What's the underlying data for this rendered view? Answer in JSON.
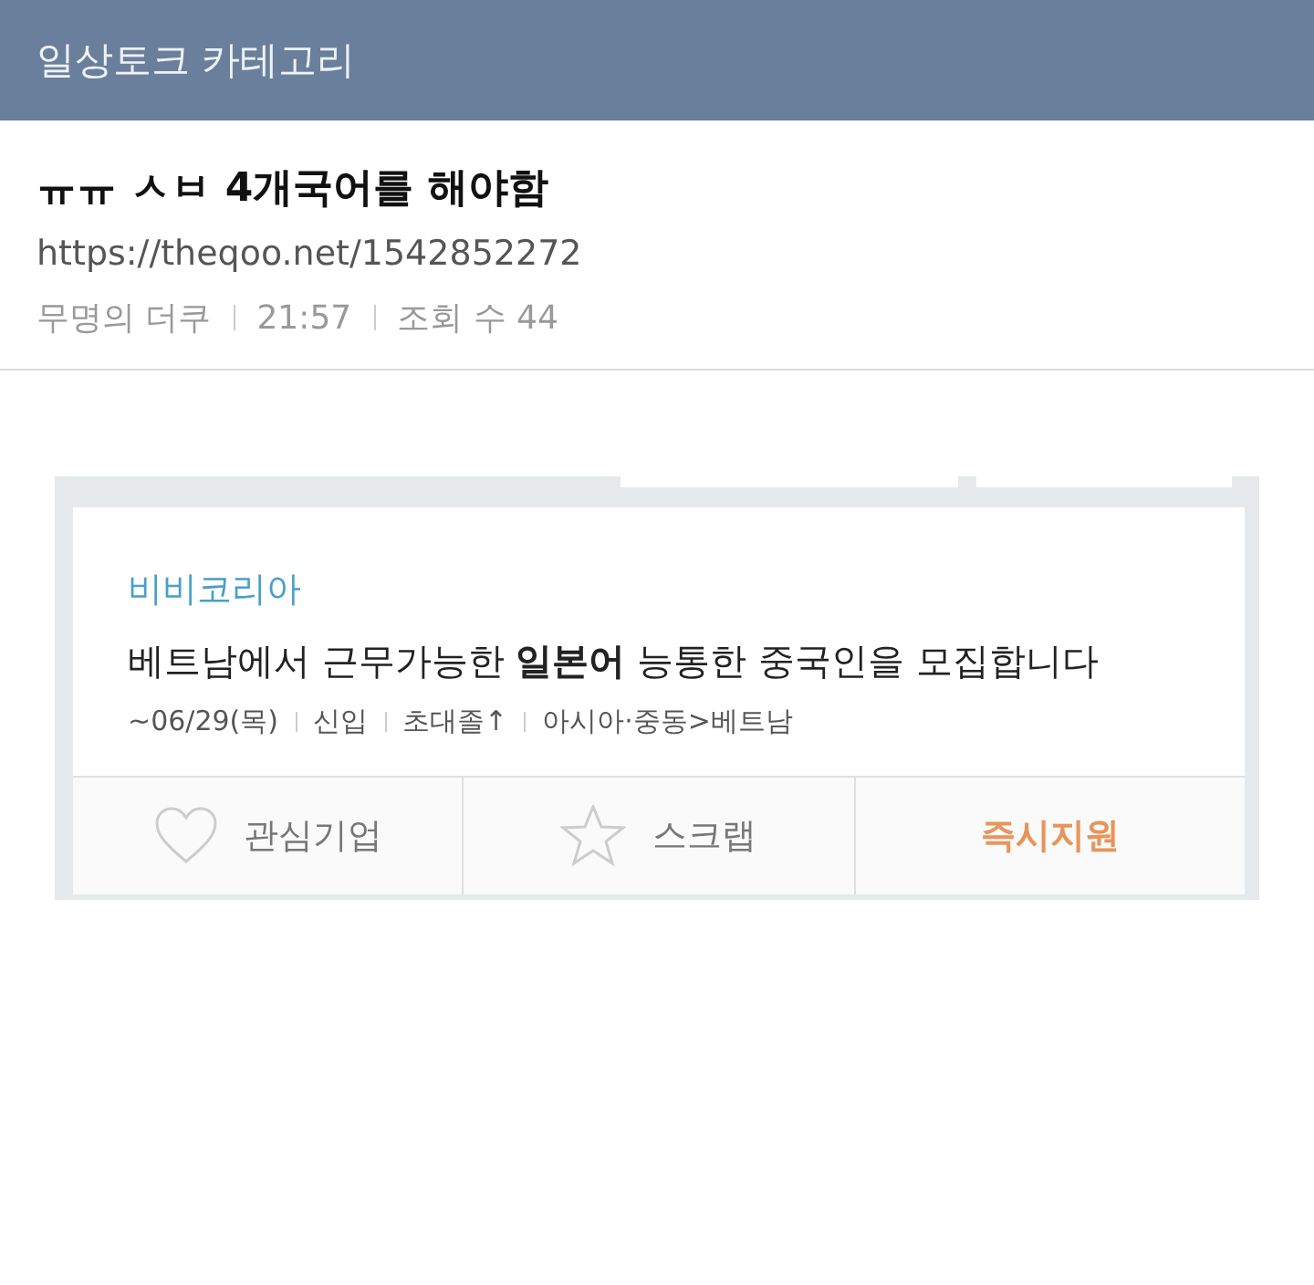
{
  "header": {
    "title": "일상토크 카테고리"
  },
  "post": {
    "title": "ㅠㅠ ㅅㅂ 4개국어를 해야함",
    "url": "https://theqoo.net/1542852272",
    "meta": [
      "무명의 더쿠",
      "21:57",
      "조회 수 44"
    ]
  },
  "job_card": {
    "company": "비비코리아",
    "title": "베트남에서 근무가능한 **일본어** 능통한 중국인을 모집합니다",
    "details": [
      "~06/29(목)",
      "신입",
      "초대졸↑",
      "아시아·중동>베트남"
    ],
    "actions": [
      {
        "kind": "heart",
        "label": "관심기업"
      },
      {
        "kind": "star",
        "label": "스크랩"
      },
      {
        "kind": "apply",
        "label": "즉시지원"
      }
    ]
  }
}
